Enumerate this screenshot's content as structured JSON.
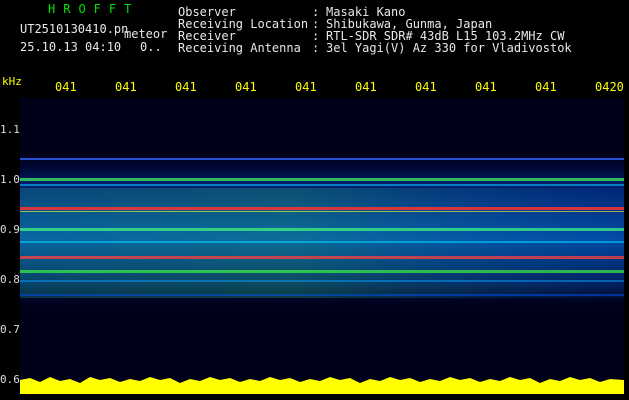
{
  "header": {
    "program_name": "HROFFT",
    "filename": "UT2510130410.pn",
    "meteor_label": "meteor",
    "datetime": "25.10.13 04:10",
    "count": "0..",
    "rows": [
      {
        "label": "Observer",
        "sep": ":",
        "value": "Masaki Kano"
      },
      {
        "label": "Receiving Location",
        "sep": ":",
        "value": "Shibukawa, Gunma, Japan"
      },
      {
        "label": "Receiver",
        "sep": ":",
        "value": "RTL-SDR SDR# 43dB L15 103.2MHz CW"
      },
      {
        "label": "Receiving Antenna",
        "sep": ":",
        "value": "3el Yagi(V) Az 330 for Vladivostok"
      }
    ]
  },
  "axis": {
    "unit": "kHz",
    "time_ticks": [
      "041",
      "041",
      "041",
      "041",
      "041",
      "041",
      "041",
      "041",
      "041",
      "0420"
    ],
    "freq_ticks": [
      "1.1",
      "1.0",
      "0.9",
      "0.8",
      "0.7",
      "0.6"
    ]
  },
  "colors": {
    "label_white": "#e8e8e8",
    "title_green": "#00e000",
    "tick_yellow": "#ffff00",
    "background": "#000000",
    "signal_red": "#ff3030"
  }
}
